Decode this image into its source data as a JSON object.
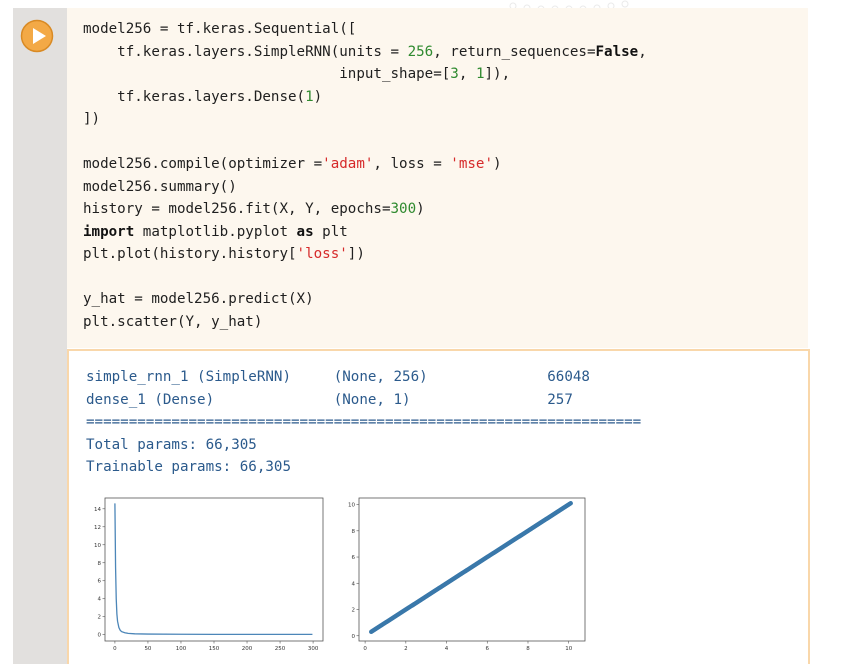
{
  "code_lines": [
    [
      {
        "t": "model256 = tf.keras.Sequential(["
      }
    ],
    [
      {
        "t": "    tf.keras.layers.SimpleRNN(units = "
      },
      {
        "t": "256",
        "c": "num"
      },
      {
        "t": ", return_sequences="
      },
      {
        "t": "False",
        "c": "kw"
      },
      {
        "t": ","
      }
    ],
    [
      {
        "t": "                              input_shape=["
      },
      {
        "t": "3",
        "c": "num"
      },
      {
        "t": ", "
      },
      {
        "t": "1",
        "c": "num"
      },
      {
        "t": "]),"
      }
    ],
    [
      {
        "t": "    tf.keras.layers.Dense("
      },
      {
        "t": "1",
        "c": "num"
      },
      {
        "t": ")"
      }
    ],
    [
      {
        "t": "])"
      }
    ],
    [
      {
        "t": ""
      }
    ],
    [
      {
        "t": "model256.compile(optimizer ="
      },
      {
        "t": "'adam'",
        "c": "str"
      },
      {
        "t": ", loss = "
      },
      {
        "t": "'mse'",
        "c": "str"
      },
      {
        "t": ")"
      }
    ],
    [
      {
        "t": "model256.summary()"
      }
    ],
    [
      {
        "t": "history = model256.fit(X, Y, epochs="
      },
      {
        "t": "300",
        "c": "num"
      },
      {
        "t": ")"
      }
    ],
    [
      {
        "t": "import",
        "c": "kw"
      },
      {
        "t": " matplotlib.pyplot "
      },
      {
        "t": "as",
        "c": "kw"
      },
      {
        "t": " plt"
      }
    ],
    [
      {
        "t": "plt.plot(history.history["
      },
      {
        "t": "'loss'",
        "c": "str"
      },
      {
        "t": "])"
      }
    ],
    [
      {
        "t": ""
      }
    ],
    [
      {
        "t": "y_hat = model256.predict(X)"
      }
    ],
    [
      {
        "t": "plt.scatter(Y, y_hat)"
      }
    ]
  ],
  "output": {
    "row1": "simple_rnn_1 (SimpleRNN)     (None, 256)              66048",
    "row2": "dense_1 (Dense)              (None, 1)                257",
    "separator": "=================================================================",
    "total": "Total params: 66,305",
    "trainable": "Trainable params: 66,305"
  },
  "colors": {
    "line": "#4c86b8",
    "scatter": "#3a78aa",
    "axis": "#555555"
  },
  "chart_data": [
    {
      "type": "line",
      "xticks": [
        0,
        50,
        100,
        150,
        200,
        250,
        300
      ],
      "yticks": [
        0,
        2,
        4,
        6,
        8,
        10,
        12,
        14
      ],
      "xlim": [
        -15,
        315
      ],
      "ylim": [
        -0.7,
        15.2
      ],
      "x": [
        0,
        1,
        2,
        3,
        4,
        6,
        8,
        10,
        15,
        20,
        30,
        50,
        100,
        150,
        200,
        250,
        299
      ],
      "y": [
        14.6,
        7.5,
        4.0,
        2.3,
        1.5,
        0.8,
        0.5,
        0.35,
        0.22,
        0.15,
        0.1,
        0.07,
        0.05,
        0.04,
        0.04,
        0.04,
        0.04
      ]
    },
    {
      "type": "scatter",
      "xticks": [
        0,
        2,
        4,
        6,
        8,
        10
      ],
      "yticks": [
        0,
        2,
        4,
        6,
        8,
        10
      ],
      "xlim": [
        -0.3,
        10.8
      ],
      "ylim": [
        -0.4,
        10.5
      ],
      "x_range": [
        0.3,
        10.1
      ],
      "y_range": [
        0.3,
        10.1
      ]
    }
  ]
}
